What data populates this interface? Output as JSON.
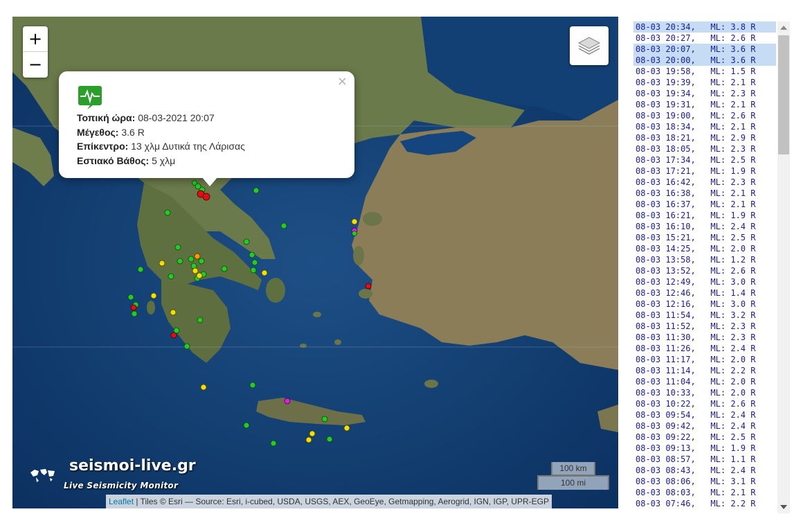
{
  "map": {
    "zoom_in_label": "+",
    "zoom_out_label": "−",
    "layers_icon": "layers-icon",
    "popup": {
      "close_label": "×",
      "icon": "seismograph-icon",
      "local_time_label": "Τοπική ώρα:",
      "local_time_value": "08-03-2021 20:07",
      "magnitude_label": "Μέγεθος:",
      "magnitude_value": "3.6 R",
      "epicenter_label": "Επίκεντρο:",
      "epicenter_value": "13 χλμ Δυτικά της Λάρισας",
      "depth_label": "Εστιακό Βάθος:",
      "depth_value": "5 χλμ"
    },
    "scale_km": "100 km",
    "scale_mi": "100 mi",
    "attribution_link": "Leaflet",
    "attribution_text": " | Tiles © Esri — Source: Esri, i-cubed, USDA, USGS, AEX, GeoEye, Getmapping, Aerogrid, IGN, IGP, UPR-EGP",
    "logo_text": "seismoi-live.gr",
    "logo_tagline": "Live Seismicity Monitor",
    "marker_colors": {
      "green": "#22cc22",
      "yellow": "#f2e000",
      "red": "#e01010",
      "magenta": "#e020e0",
      "orange": "#ff9900"
    }
  },
  "quake_list": [
    {
      "date": "08-03",
      "time": "20:34",
      "ml": "3.8 R",
      "highlight": true
    },
    {
      "date": "08-03",
      "time": "20:27",
      "ml": "2.6 R",
      "highlight": false
    },
    {
      "date": "08-03",
      "time": "20:07",
      "ml": "3.6 R",
      "highlight": true
    },
    {
      "date": "08-03",
      "time": "20:00",
      "ml": "3.6 R",
      "highlight": true
    },
    {
      "date": "08-03",
      "time": "19:58",
      "ml": "1.5 R",
      "highlight": false
    },
    {
      "date": "08-03",
      "time": "19:39",
      "ml": "2.1 R",
      "highlight": false
    },
    {
      "date": "08-03",
      "time": "19:34",
      "ml": "2.3 R",
      "highlight": false
    },
    {
      "date": "08-03",
      "time": "19:31",
      "ml": "2.1 R",
      "highlight": false
    },
    {
      "date": "08-03",
      "time": "19:00",
      "ml": "2.6 R",
      "highlight": false
    },
    {
      "date": "08-03",
      "time": "18:34",
      "ml": "2.1 R",
      "highlight": false
    },
    {
      "date": "08-03",
      "time": "18:21",
      "ml": "2.9 R",
      "highlight": false
    },
    {
      "date": "08-03",
      "time": "18:05",
      "ml": "2.3 R",
      "highlight": false
    },
    {
      "date": "08-03",
      "time": "17:34",
      "ml": "2.5 R",
      "highlight": false
    },
    {
      "date": "08-03",
      "time": "17:21",
      "ml": "1.9 R",
      "highlight": false
    },
    {
      "date": "08-03",
      "time": "16:42",
      "ml": "2.3 R",
      "highlight": false
    },
    {
      "date": "08-03",
      "time": "16:38",
      "ml": "2.1 R",
      "highlight": false
    },
    {
      "date": "08-03",
      "time": "16:37",
      "ml": "2.1 R",
      "highlight": false
    },
    {
      "date": "08-03",
      "time": "16:21",
      "ml": "1.9 R",
      "highlight": false
    },
    {
      "date": "08-03",
      "time": "16:10",
      "ml": "2.4 R",
      "highlight": false
    },
    {
      "date": "08-03",
      "time": "15:21",
      "ml": "2.5 R",
      "highlight": false
    },
    {
      "date": "08-03",
      "time": "14:25",
      "ml": "2.0 R",
      "highlight": false
    },
    {
      "date": "08-03",
      "time": "13:58",
      "ml": "1.2 R",
      "highlight": false
    },
    {
      "date": "08-03",
      "time": "13:52",
      "ml": "2.6 R",
      "highlight": false
    },
    {
      "date": "08-03",
      "time": "12:49",
      "ml": "3.0 R",
      "highlight": false
    },
    {
      "date": "08-03",
      "time": "12:46",
      "ml": "1.4 R",
      "highlight": false
    },
    {
      "date": "08-03",
      "time": "12:16",
      "ml": "3.0 R",
      "highlight": false
    },
    {
      "date": "08-03",
      "time": "11:54",
      "ml": "3.2 R",
      "highlight": false
    },
    {
      "date": "08-03",
      "time": "11:52",
      "ml": "2.3 R",
      "highlight": false
    },
    {
      "date": "08-03",
      "time": "11:30",
      "ml": "2.3 R",
      "highlight": false
    },
    {
      "date": "08-03",
      "time": "11:26",
      "ml": "2.4 R",
      "highlight": false
    },
    {
      "date": "08-03",
      "time": "11:17",
      "ml": "2.0 R",
      "highlight": false
    },
    {
      "date": "08-03",
      "time": "11:14",
      "ml": "2.2 R",
      "highlight": false
    },
    {
      "date": "08-03",
      "time": "11:04",
      "ml": "2.0 R",
      "highlight": false
    },
    {
      "date": "08-03",
      "time": "10:33",
      "ml": "2.0 R",
      "highlight": false
    },
    {
      "date": "08-03",
      "time": "10:22",
      "ml": "2.6 R",
      "highlight": false
    },
    {
      "date": "08-03",
      "time": "09:54",
      "ml": "2.4 R",
      "highlight": false
    },
    {
      "date": "08-03",
      "time": "09:42",
      "ml": "2.4 R",
      "highlight": false
    },
    {
      "date": "08-03",
      "time": "09:22",
      "ml": "2.5 R",
      "highlight": false
    },
    {
      "date": "08-03",
      "time": "09:13",
      "ml": "1.9 R",
      "highlight": false
    },
    {
      "date": "08-03",
      "time": "08:57",
      "ml": "1.1 R",
      "highlight": false
    },
    {
      "date": "08-03",
      "time": "08:43",
      "ml": "2.4 R",
      "highlight": false
    },
    {
      "date": "08-03",
      "time": "08:06",
      "ml": "3.1 R",
      "highlight": false
    },
    {
      "date": "08-03",
      "time": "08:03",
      "ml": "2.1 R",
      "highlight": false
    },
    {
      "date": "08-03",
      "time": "07:46",
      "ml": "2.2 R",
      "highlight": false
    }
  ],
  "ml_label": "ML:"
}
